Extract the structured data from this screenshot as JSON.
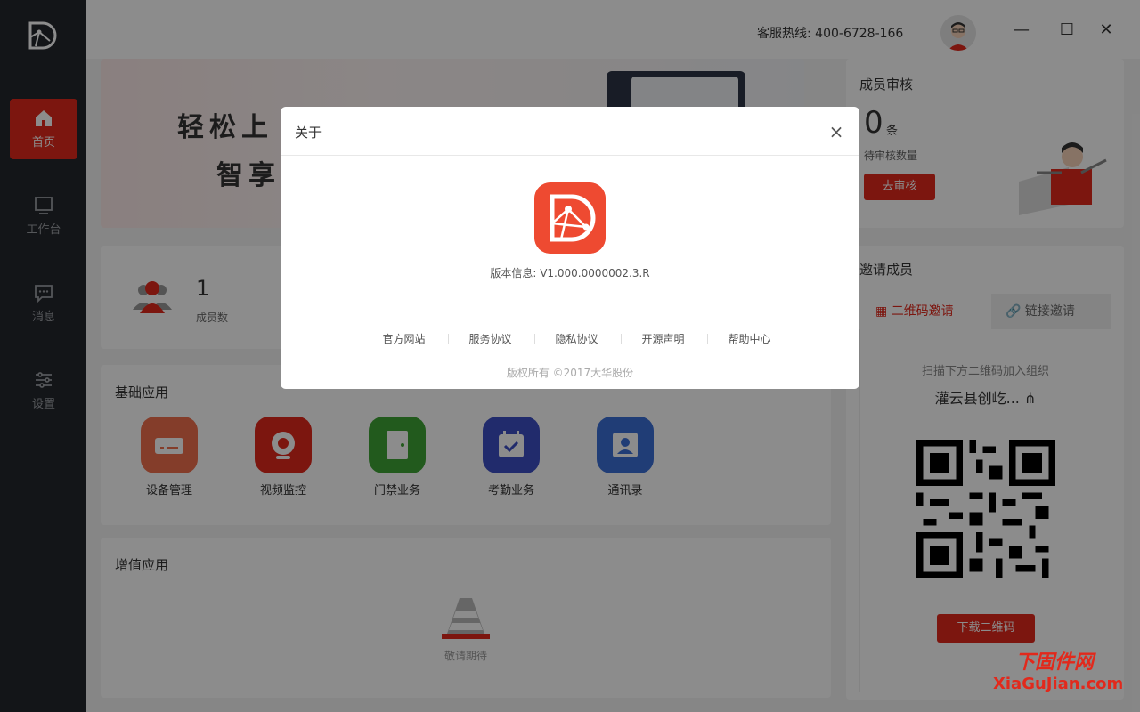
{
  "sidebar": {
    "items": [
      {
        "label": "首页",
        "icon": "home-icon",
        "active": true
      },
      {
        "label": "工作台",
        "icon": "monitor-icon",
        "active": false
      },
      {
        "label": "消息",
        "icon": "message-icon",
        "active": false
      },
      {
        "label": "设置",
        "icon": "sliders-icon",
        "active": false
      }
    ]
  },
  "header": {
    "hotline": "客服热线: 400-6728-166",
    "window_controls": [
      "minimize",
      "maximize",
      "close"
    ]
  },
  "banner": {
    "line1": "轻松上",
    "line2": "智享"
  },
  "stats": {
    "member_count": "1",
    "member_label": "成员数"
  },
  "basic_apps": {
    "title": "基础应用",
    "items": [
      {
        "label": "设备管理",
        "icon": "device-icon",
        "color": "#f0704d"
      },
      {
        "label": "视频监控",
        "icon": "camera-icon",
        "color": "#e2291c"
      },
      {
        "label": "门禁业务",
        "icon": "door-icon",
        "color": "#3fa535"
      },
      {
        "label": "考勤业务",
        "icon": "calendar-icon",
        "color": "#3d4fc5"
      },
      {
        "label": "通讯录",
        "icon": "contacts-icon",
        "color": "#3b6fd8"
      }
    ]
  },
  "value_apps": {
    "title": "增值应用",
    "coming_soon": "敬请期待"
  },
  "review": {
    "title": "成员审核",
    "count": "0",
    "unit": "条",
    "subtitle": "待审核数量",
    "button": "去审核"
  },
  "invite": {
    "title": "邀请成员",
    "tabs": [
      "二维码邀请",
      "链接邀请"
    ],
    "active_tab": "二维码邀请",
    "scan_tip": "扫描下方二维码加入组织",
    "org_name": "灌云县创屹...",
    "download_button": "下载二维码"
  },
  "modal": {
    "title": "关于",
    "version": "版本信息: V1.000.0000002.3.R",
    "links": [
      "官方网站",
      "服务协议",
      "隐私协议",
      "开源声明",
      "帮助中心"
    ],
    "copyright": "版权所有 ©2017大华股份"
  },
  "watermark": {
    "cn": "下固件网",
    "en": "XiaGuJian.com"
  },
  "colors": {
    "accent": "#e2291c",
    "sidebar_bg": "#24272c"
  }
}
